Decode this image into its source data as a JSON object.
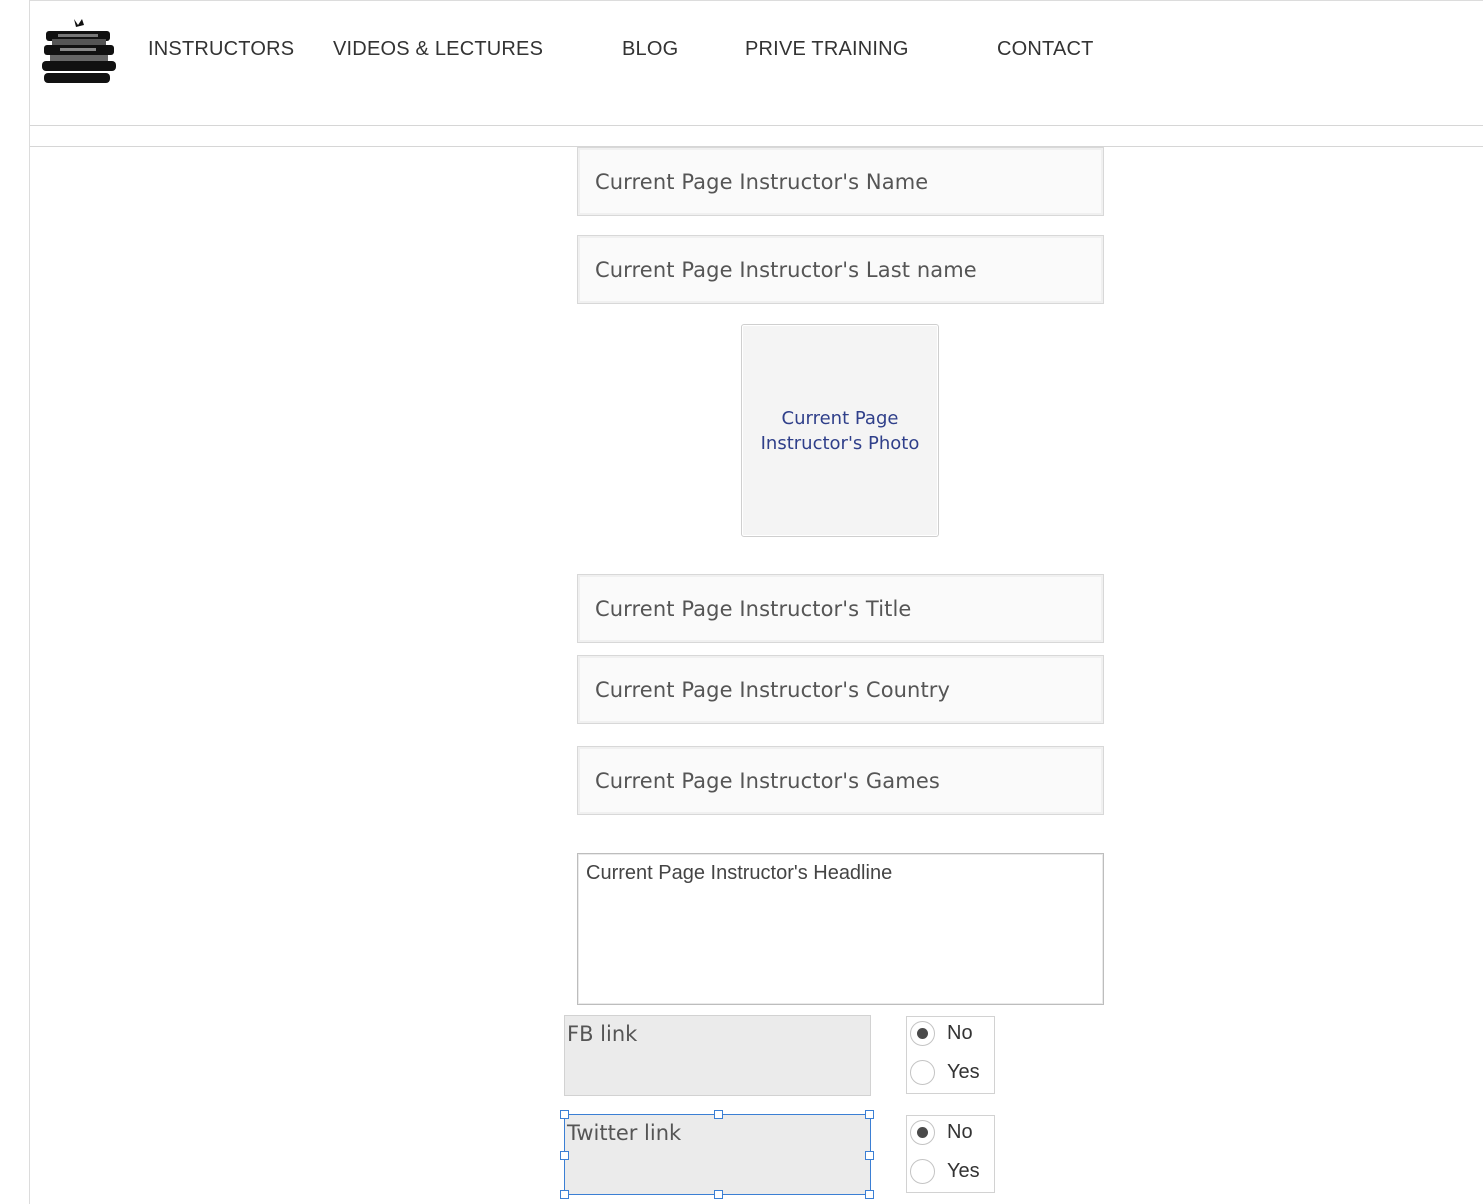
{
  "nav": {
    "items": [
      {
        "label": "INSTRUCTORS"
      },
      {
        "label": "VIDEOS & LECTURES"
      },
      {
        "label": "BLOG"
      },
      {
        "label": "PRIVE TRAINING"
      },
      {
        "label": "CONTACT"
      }
    ]
  },
  "logo": {
    "icon": "chess-pieces-logo-icon"
  },
  "form": {
    "name": "Current Page Instructor's Name",
    "last_name": "Current Page Instructor's Last name",
    "photo": "Current Page Instructor's Photo",
    "title": "Current Page Instructor's Title",
    "country": "Current Page Instructor's Country",
    "games": "Current Page Instructor's Games",
    "headline": "Current Page Instructor's Headline",
    "fb_link": "FB link",
    "twitter_link": "Twitter link",
    "fb_options": [
      {
        "label": "No",
        "selected": true
      },
      {
        "label": "Yes",
        "selected": false
      }
    ],
    "twitter_options": [
      {
        "label": "No",
        "selected": true
      },
      {
        "label": "Yes",
        "selected": false
      }
    ]
  },
  "colors": {
    "selection_outline": "#3b7fd4",
    "photo_label": "#2f3f8a"
  }
}
